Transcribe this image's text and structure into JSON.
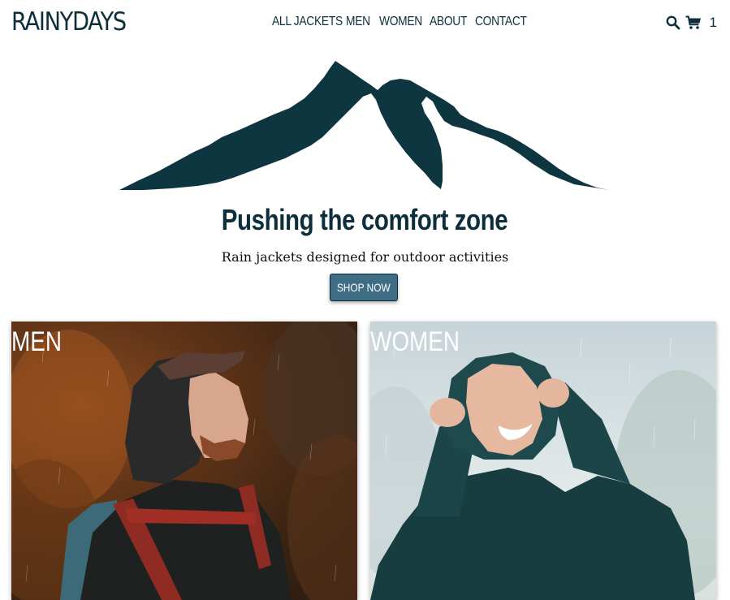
{
  "header": {
    "logo": "RAINYDAYS",
    "nav": [
      {
        "label": "ALL JACKETS"
      },
      {
        "label": "MEN"
      },
      {
        "label": "WOMEN"
      },
      {
        "label": "ABOUT"
      },
      {
        "label": "CONTACT"
      }
    ],
    "search_icon": "search-icon",
    "cart_icon": "cart-icon",
    "cart_count": "1"
  },
  "hero": {
    "title": "Pushing the comfort zone",
    "subtitle": "Rain jackets designed for outdoor activities",
    "cta_label": "SHOP NOW",
    "image": "mountain-silhouette"
  },
  "categories": [
    {
      "label": "MEN",
      "image": "man-in-rain-jacket-photo"
    },
    {
      "label": "WOMEN",
      "image": "woman-in-rain-jacket-photo"
    }
  ],
  "colors": {
    "brand": "#0d2f3c",
    "button": "#3f6d86"
  }
}
